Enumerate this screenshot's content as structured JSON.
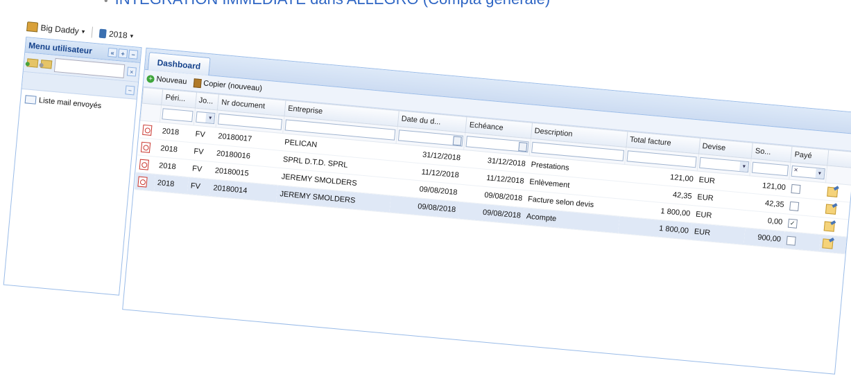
{
  "caption": {
    "bullet": "•",
    "text": "INTEGRATION IMMEDIATE dans ALLEGRO (Compta générale)"
  },
  "topbar": {
    "company": "Big Daddy",
    "year": "2018"
  },
  "sidebar": {
    "title": "Menu utilisateur",
    "tools": [
      "«",
      "+",
      "−"
    ],
    "clear_button": "×",
    "collapse_button": "−",
    "items": [
      {
        "label": "Liste mail envoyés"
      }
    ]
  },
  "main": {
    "tab": "Dashboard",
    "toolbar": {
      "new_label": "Nouveau",
      "copy_label": "Copier (nouveau)"
    },
    "columns": [
      "Péri...",
      "Jo...",
      "Nr document",
      "Entreprise",
      "Date du d...",
      "Echéance",
      "Description",
      "Total facture",
      "Devise",
      "So...",
      "Payé"
    ],
    "filter_clear": "×",
    "rows": [
      {
        "periode": "2018",
        "journal": "FV",
        "nr": "20180017",
        "entreprise": "PELICAN",
        "date": "31/12/2018",
        "echeance": "31/12/2018",
        "description": "Prestations",
        "total": "121,00",
        "devise": "EUR",
        "solde": "121,00",
        "paye": ""
      },
      {
        "periode": "2018",
        "journal": "FV",
        "nr": "20180016",
        "entreprise": "SPRL D.T.D. SPRL",
        "date": "11/12/2018",
        "echeance": "11/12/2018",
        "description": "Enlèvement",
        "total": "42,35",
        "devise": "EUR",
        "solde": "42,35",
        "paye": ""
      },
      {
        "periode": "2018",
        "journal": "FV",
        "nr": "20180015",
        "entreprise": "JEREMY SMOLDERS",
        "date": "09/08/2018",
        "echeance": "09/08/2018",
        "description": "Facture selon devis",
        "total": "1 800,00",
        "devise": "EUR",
        "solde": "0,00",
        "paye": "✓"
      },
      {
        "periode": "2018",
        "journal": "FV",
        "nr": "20180014",
        "entreprise": "JEREMY SMOLDERS",
        "date": "09/08/2018",
        "echeance": "09/08/2018",
        "description": "Acompte",
        "total": "1 800,00",
        "devise": "EUR",
        "solde": "900,00",
        "paye": ""
      }
    ]
  }
}
